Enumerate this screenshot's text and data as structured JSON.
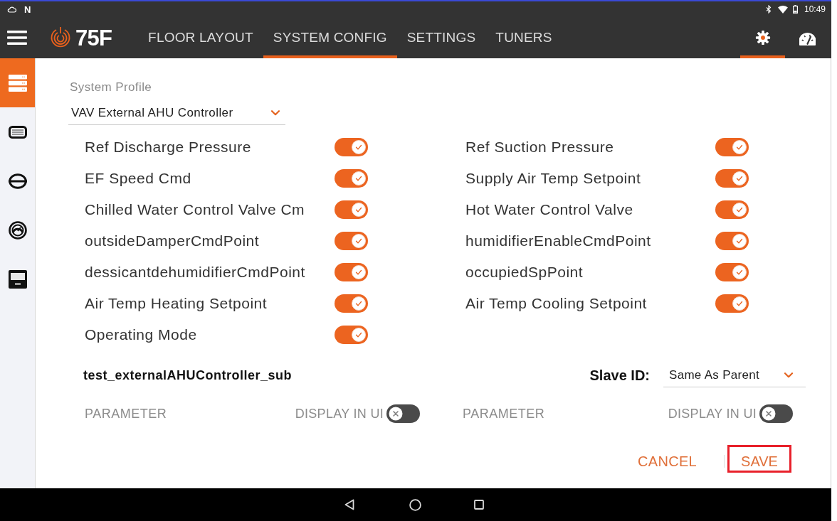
{
  "status_bar": {
    "notification_glyph": "N",
    "time": "10:49"
  },
  "nav": {
    "logo": "75F",
    "tabs": [
      {
        "label": "FLOOR LAYOUT",
        "selected": false
      },
      {
        "label": "SYSTEM CONFIG",
        "selected": true
      },
      {
        "label": "SETTINGS",
        "selected": false
      },
      {
        "label": "TUNERS",
        "selected": false
      }
    ],
    "icon_tabs": [
      {
        "selected": true
      },
      {
        "selected": false
      }
    ]
  },
  "sidebar": {
    "items": [
      {
        "selected": true
      },
      {
        "selected": false
      },
      {
        "selected": false
      },
      {
        "selected": false
      },
      {
        "selected": false
      }
    ]
  },
  "system_profile": {
    "label": "System Profile",
    "value": "VAV External AHU Controller"
  },
  "points": [
    {
      "label": "Ref Discharge Pressure",
      "on": true
    },
    {
      "label": "Ref Suction Pressure",
      "on": true
    },
    {
      "label": "EF Speed Cmd",
      "on": true
    },
    {
      "label": "Supply Air Temp Setpoint",
      "on": true
    },
    {
      "label": "Chilled Water Control Valve Cm",
      "on": true
    },
    {
      "label": "Hot Water Control Valve",
      "on": true
    },
    {
      "label": "outsideDamperCmdPoint",
      "on": true
    },
    {
      "label": "humidifierEnableCmdPoint",
      "on": true
    },
    {
      "label": "dessicantdehumidifierCmdPoint",
      "on": true
    },
    {
      "label": "occupiedSpPoint",
      "on": true
    },
    {
      "label": "Air Temp Heating Setpoint",
      "on": true
    },
    {
      "label": "Air Temp Cooling Setpoint",
      "on": true
    },
    {
      "label": "Operating Mode",
      "on": true
    }
  ],
  "equip": {
    "name": "test_externalAHUController_sub",
    "slave_id_label": "Slave ID:",
    "slave_id_value": "Same As Parent"
  },
  "parameter_headers": [
    {
      "column_label": "PARAMETER",
      "toggle_label": "DISPLAY IN UI",
      "on": false
    },
    {
      "column_label": "PARAMETER",
      "toggle_label": "DISPLAY IN UI",
      "on": false
    }
  ],
  "buttons": [
    {
      "label": "CANCEL",
      "highlighted": false
    },
    {
      "label": "SAVE",
      "highlighted": true
    }
  ]
}
